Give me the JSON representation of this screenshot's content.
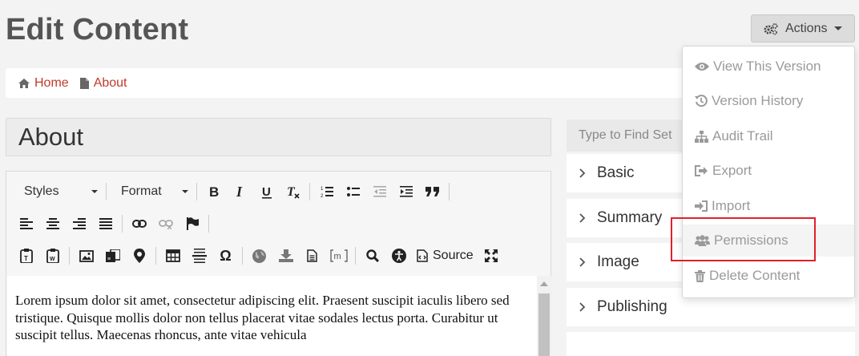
{
  "page": {
    "title": "Edit Content"
  },
  "actions": {
    "label": "Actions"
  },
  "breadcrumb": [
    {
      "label": "Home",
      "icon": "home-icon"
    },
    {
      "label": "About",
      "icon": "file-icon"
    }
  ],
  "content_title": "About",
  "editor": {
    "styles_label": "Styles",
    "format_label": "Format",
    "source_label": "Source",
    "body_text": "Lorem ipsum dolor sit amet, consectetur adipiscing elit. Praesent suscipit iaculis libero sed tristique. Quisque mollis dolor non tellus placerat vitae sodales lectus porta. Curabitur ut suscipit tellus. Maecenas rhoncus, ante vitae vehicula"
  },
  "sidebar": {
    "search_placeholder": "Type to Find Set",
    "sections": [
      {
        "label": "Basic"
      },
      {
        "label": "Summary"
      },
      {
        "label": "Image"
      },
      {
        "label": "Publishing"
      }
    ]
  },
  "actions_menu": {
    "items": [
      {
        "label": "View This Version",
        "icon": "eye-icon"
      },
      {
        "label": "Version History",
        "icon": "history-icon"
      },
      {
        "label": "Audit Trail",
        "icon": "sitemap-icon"
      },
      {
        "label": "Export",
        "icon": "export-icon"
      },
      {
        "label": "Import",
        "icon": "import-icon"
      },
      {
        "label": "Permissions",
        "icon": "users-icon"
      },
      {
        "label": "Delete Content",
        "icon": "trash-icon"
      }
    ]
  },
  "colors": {
    "link": "#c0392b",
    "highlight": "#e0202a"
  }
}
